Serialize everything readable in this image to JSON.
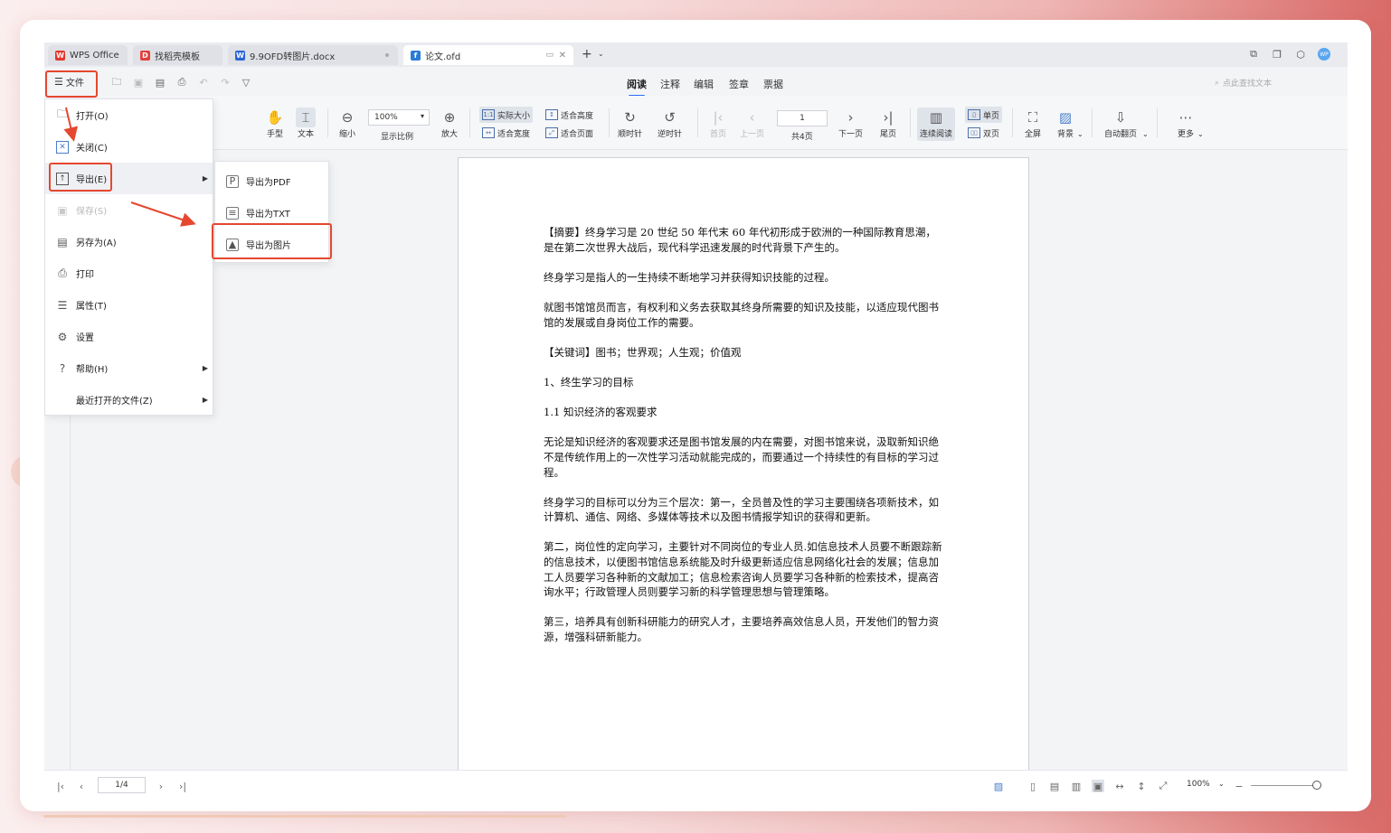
{
  "tabs": [
    {
      "label": "WPS Office",
      "logo": "W",
      "color": "#e5352b"
    },
    {
      "label": "找稻壳模板",
      "logo": "D",
      "color": "#e2403a"
    },
    {
      "label": "9.9OFD转图片.docx",
      "logo": "W",
      "color": "#2b64d6"
    },
    {
      "label": "论文.ofd",
      "logo": "f",
      "color": "#2b7cd6"
    }
  ],
  "file_button": "文件",
  "ribbon_tabs": [
    "阅读",
    "注释",
    "编辑",
    "签章",
    "票据"
  ],
  "search_placeholder": "点此查找文本",
  "toolbar": {
    "hand": "手型",
    "text": "文本",
    "zoom_out": "缩小",
    "zoom_value": "100%",
    "zoom_ratio": "显示比例",
    "zoom_in": "放大",
    "actual_size": "实际大小",
    "fit_height": "适合高度",
    "fit_width": "适合宽度",
    "fit_page": "适合页面",
    "clockwise": "顺时针",
    "counter_clockwise": "逆时针",
    "first_page": "首页",
    "prev_page": "上一页",
    "page_input": "1",
    "total_pages": "共4页",
    "next_page": "下一页",
    "last_page": "尾页",
    "continuous": "连续阅读",
    "single": "单页",
    "double": "双页",
    "fullscreen": "全屏",
    "background": "背景",
    "auto_flip": "自动翻页",
    "more": "更多"
  },
  "file_menu": [
    {
      "label": "打开(O)",
      "icon": "folder-icon"
    },
    {
      "label": "关闭(C)",
      "icon": "close-icon"
    },
    {
      "label": "导出(E)",
      "icon": "export-icon"
    },
    {
      "label": "保存(S)",
      "icon": "save-icon"
    },
    {
      "label": "另存为(A)",
      "icon": "save-as-icon"
    },
    {
      "label": "打印",
      "icon": "print-icon"
    },
    {
      "label": "属性(T)",
      "icon": "properties-icon"
    },
    {
      "label": "设置",
      "icon": "gear-icon"
    },
    {
      "label": "帮助(H)",
      "icon": "help-icon"
    },
    {
      "label": "最近打开的文件(Z)",
      "icon": ""
    }
  ],
  "export_menu": [
    "导出为PDF",
    "导出为TXT",
    "导出为图片"
  ],
  "document": {
    "paragraphs": [
      "【摘要】终身学习是 20 世纪 50 年代末 60 年代初形成于欧洲的一种国际教育思潮，是在第二次世界大战后，现代科学迅速发展的时代背景下产生的。",
      "终身学习是指人的一生持续不断地学习并获得知识技能的过程。",
      "就图书馆馆员而言，有权利和义务去获取其终身所需要的知识及技能，以适应现代图书馆的发展或自身岗位工作的需要。",
      "【关键词】图书；世界观；人生观；价值观",
      "1、终生学习的目标",
      "1.1 知识经济的客观要求",
      "无论是知识经济的客观要求还是图书馆发展的内在需要，对图书馆来说，汲取新知识绝不是传统作用上的一次性学习活动就能完成的，而要通过一个持续性的有目标的学习过程。",
      "终身学习的目标可以分为三个层次：第一，全员普及性的学习主要围绕各项新技术，如计算机、通信、网络、多媒体等技术以及图书情报学知识的获得和更新。",
      "第二，岗位性的定向学习，主要针对不同岗位的专业人员.如信息技术人员要不断跟踪新的信息技术，以便图书馆信息系统能及时升级更新适应信息网络化社会的发展；信息加工人员要学习各种新的文献加工；信息检索咨询人员要学习各种新的检索技术，提高咨询水平；行政管理人员则要学习新的科学管理思想与管理策略。",
      "第三，培养具有创新科研能力的研究人才，主要培养高效信息人员，开发他们的智力资源，增强科研新能力。"
    ]
  },
  "statusbar": {
    "page_value": "1/4",
    "zoom": "100%"
  },
  "colors": {
    "accent": "#2f6bff",
    "highlight_box": "#e5472f"
  }
}
